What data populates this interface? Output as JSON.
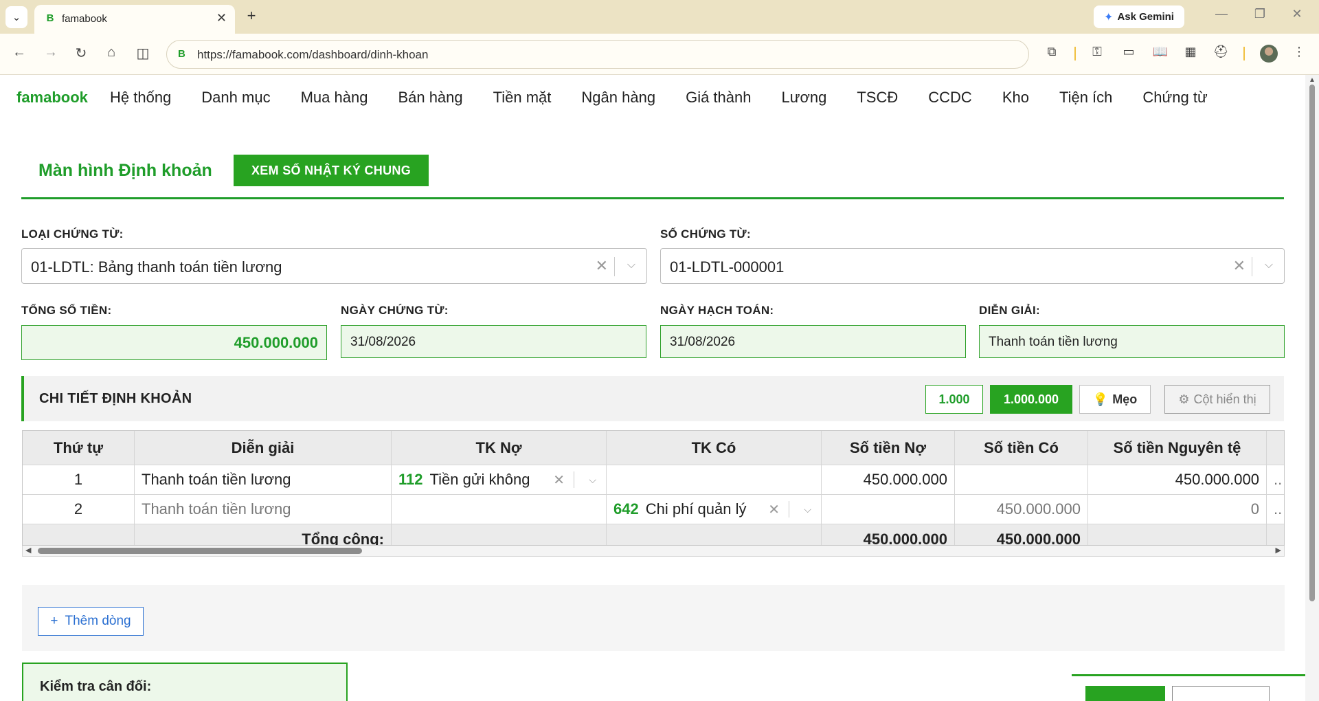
{
  "browser": {
    "tab_title": "famabook",
    "url": "https://famabook.com/dashboard/dinh-khoan",
    "gemini_label": "Ask Gemini"
  },
  "app": {
    "brand": "famabook",
    "menu": [
      "Hệ thống",
      "Danh mục",
      "Mua hàng",
      "Bán hàng",
      "Tiền mặt",
      "Ngân hàng",
      "Giá thành",
      "Lương",
      "TSCĐ",
      "CCDC",
      "Kho",
      "Tiện ích",
      "Chứng từ"
    ],
    "page_title": "Màn hình Định khoản",
    "journal_button": "XEM SỐ NHẬT KÝ CHUNG",
    "form": {
      "voucher_type_label": "LOẠI CHỨNG TỪ:",
      "voucher_type_value": "01-LDTL: Bảng thanh toán tiền lương",
      "voucher_no_label": "SỐ CHỨNG TỪ:",
      "voucher_no_value": "01-LDTL-000001",
      "total_label": "TỔNG SỐ TIỀN:",
      "total_value": "450.000.000",
      "voucher_date_label": "NGÀY CHỨNG TỪ:",
      "voucher_date_value": "31/08/2026",
      "posting_date_label": "NGÀY HẠCH TOÁN:",
      "posting_date_value": "31/08/2026",
      "desc_label": "DIỄN GIẢI:",
      "desc_value": "Thanh toán tiền lương"
    },
    "detail": {
      "title": "CHI TIẾT ĐỊNH KHOẢN",
      "unit_1": "1.000",
      "unit_2": "1.000.000",
      "tips": "Mẹo",
      "columns_btn": "Cột hiển thị"
    },
    "table": {
      "headers": [
        "Thứ tự",
        "Diễn giải",
        "TK Nợ",
        "TK Có",
        "Số tiền Nợ",
        "Số tiền Có",
        "Số tiền Nguyên tệ"
      ],
      "rows": [
        {
          "order": "1",
          "desc": "Thanh toán tiền lương",
          "debit_code": "112",
          "debit_name": "Tiền gửi không",
          "credit_code": "",
          "credit_name": "",
          "debit_amt": "450.000.000",
          "credit_amt": "",
          "fx_amt": "450.000.000"
        },
        {
          "order": "2",
          "desc": "Thanh toán tiền lương",
          "debit_code": "",
          "debit_name": "",
          "credit_code": "642",
          "credit_name": "Chi phí quản lý",
          "debit_amt": "",
          "credit_amt": "450.000.000",
          "fx_amt": "0"
        }
      ],
      "totals": {
        "label": "Tổng cộng:",
        "debit": "450.000.000",
        "credit": "450.000.000"
      }
    },
    "add_row": "Thêm dòng",
    "balance_title": "Kiểm tra cân đối:"
  }
}
